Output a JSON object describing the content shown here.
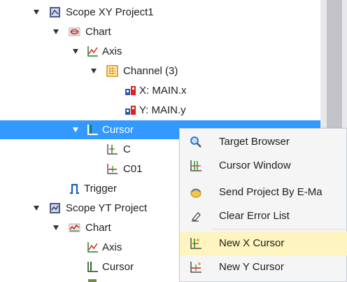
{
  "tree": {
    "items": [
      {
        "label": "Scope XY Project1",
        "icon": "scope-project-icon"
      },
      {
        "label": "Chart",
        "icon": "chart-icon"
      },
      {
        "label": "Axis",
        "icon": "axis-icon"
      },
      {
        "label": "Channel (3)",
        "icon": "channel-icon"
      },
      {
        "label": "X: MAIN.x",
        "icon": "variable-icon"
      },
      {
        "label": "Y: MAIN.y",
        "icon": "variable-icon"
      },
      {
        "label": "Cursor",
        "icon": "cursor-icon"
      },
      {
        "label": "C",
        "icon": "x-cursor-icon"
      },
      {
        "label": "C01",
        "icon": "y-cursor-icon"
      },
      {
        "label": "Trigger",
        "icon": "trigger-icon"
      },
      {
        "label": "Scope YT Project",
        "icon": "scope-project-icon"
      },
      {
        "label": "Chart",
        "icon": "chart-icon"
      },
      {
        "label": "Axis",
        "icon": "axis-icon"
      },
      {
        "label": "Cursor",
        "icon": "cursor-icon"
      }
    ]
  },
  "context_menu": {
    "items": [
      {
        "label": "Target Browser",
        "icon": "target-browser-icon"
      },
      {
        "label": "Cursor Window",
        "icon": "cursor-window-icon"
      },
      {
        "label": "Send Project By E-Ma",
        "icon": "send-email-icon"
      },
      {
        "label": "Clear Error List",
        "icon": "clear-error-icon"
      },
      {
        "label": "New X Cursor",
        "icon": "new-x-cursor-icon"
      },
      {
        "label": "New Y Cursor",
        "icon": "new-y-cursor-icon"
      }
    ]
  },
  "colors": {
    "selection": "#3399ff",
    "menu_highlight": "#fdf4bf",
    "menu_bg": "#f5f5f5"
  }
}
